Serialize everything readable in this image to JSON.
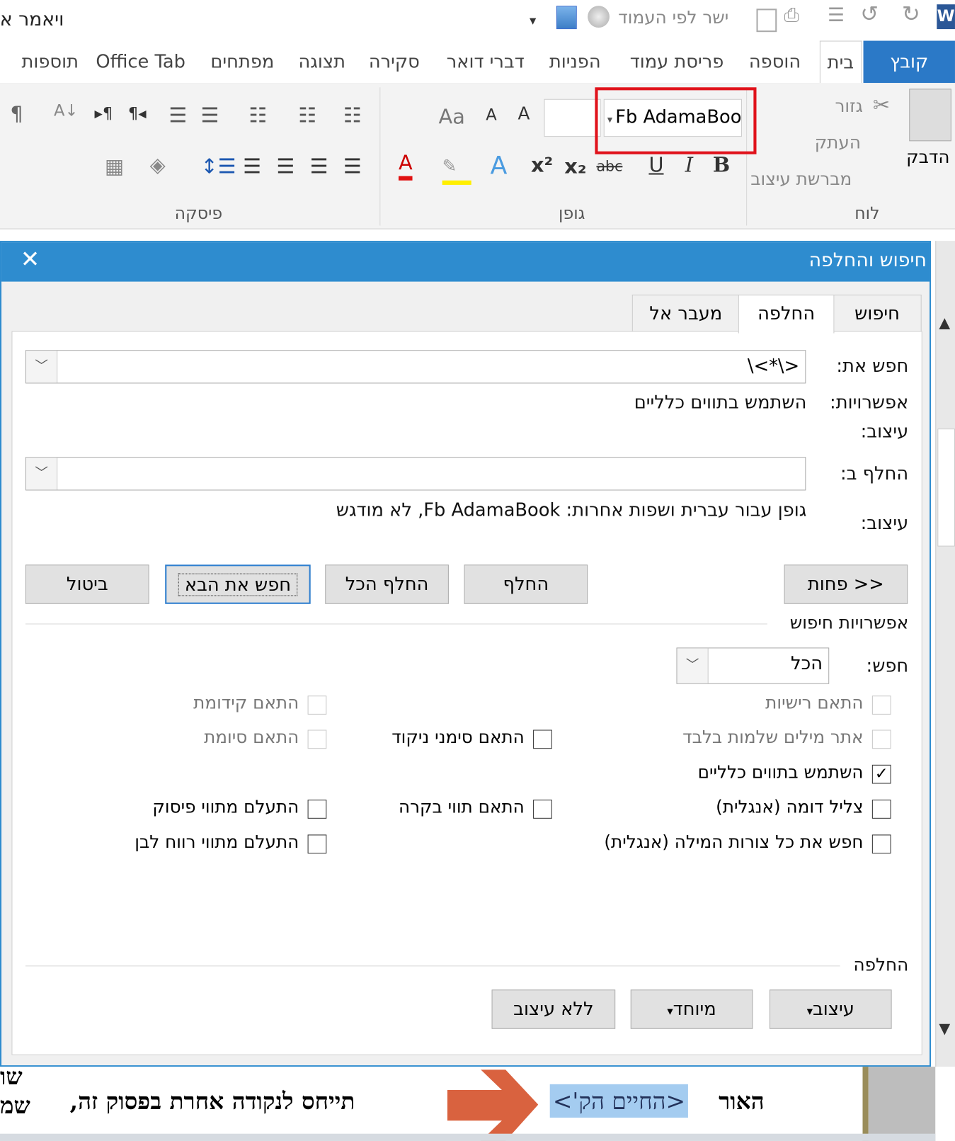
{
  "titlebar": {
    "document_title": "ויאמר א",
    "qat_fit_label": "ישר לפי העמוד",
    "word_icon": "W"
  },
  "ribbon_tabs": [
    "קובץ",
    "בית",
    "הוספה",
    "פריסת עמוד",
    "הפניות",
    "דברי דואר",
    "סקירה",
    "תצוגה",
    "מפתחים",
    "Office Tab",
    "תוספות"
  ],
  "ribbon": {
    "clipboard": {
      "label": "לוח",
      "paste": "הדבק",
      "cut": "גזור",
      "copy": "העתק",
      "format_painter": "מברשת עיצוב"
    },
    "font": {
      "label": "גופן",
      "font_name": "Fb AdamaBoo",
      "bold": "B",
      "italic": "I",
      "underline": "U",
      "strike": "abc",
      "sub": "x₂",
      "sup": "x²",
      "color_a": "A",
      "grow": "A",
      "shrink": "A",
      "case": "Aa"
    },
    "paragraph": {
      "label": "פיסקה",
      "pilcrow": "¶"
    }
  },
  "dialog": {
    "title": "חיפוש והחלפה",
    "tabs": [
      "חיפוש",
      "החלפה",
      "מעבר אל"
    ],
    "find_label": "חפש את:",
    "find_value": "\\<*\\>",
    "options_label": "אפשרויות:",
    "options_value": "השתמש בתווים כלליים",
    "format_label": "עיצוב:",
    "replace_label": "החלף ב:",
    "replace_value": "",
    "replace_format_label": "עיצוב:",
    "replace_format_value": "גופן עבור עברית ושפות אחרות: Fb AdamaBook, לא מודגש",
    "buttons": {
      "less": "<< פחות",
      "replace": "החלף",
      "replace_all": "החלף הכל",
      "find_next": "חפש את הבא",
      "cancel": "ביטול"
    },
    "search_options_title": "אפשרויות חיפוש",
    "search_label": "חפש:",
    "search_value": "הכל",
    "checkboxes": [
      {
        "label": "התאם רישיות",
        "checked": false,
        "disabled": true
      },
      {
        "label": "התאם קידומת",
        "checked": false,
        "disabled": true
      },
      {
        "label": "אתר מילים שלמות בלבד",
        "checked": false,
        "disabled": true
      },
      {
        "label": "התאם סימני ניקוד",
        "checked": false,
        "disabled": false
      },
      {
        "label": "התאם סיומת",
        "checked": false,
        "disabled": true
      },
      {
        "label": "השתמש בתווים כלליים",
        "checked": true,
        "disabled": false
      },
      {
        "label": "צליל דומה (אנגלית)",
        "checked": false,
        "disabled": false
      },
      {
        "label": "התאם תווי בקרה",
        "checked": false,
        "disabled": false
      },
      {
        "label": "התעלם מתווי פיסוק",
        "checked": false,
        "disabled": false
      },
      {
        "label": "חפש את כל צורות המילה (אנגלית)",
        "checked": false,
        "disabled": false
      },
      {
        "label": "התעלם מתווי רווח לבן",
        "checked": false,
        "disabled": false
      }
    ],
    "replace_section_title": "החלפה",
    "bottom_buttons": {
      "format": "עיצוב",
      "special": "מיוחד",
      "no_format": "ללא עיצוב"
    }
  },
  "document": {
    "word1": "האור",
    "highlight": "<החיים הק'>",
    "rest": "תייחס לנקודה אחרת בפסוק זה,",
    "edge1": "שו",
    "edge2": "שמ"
  },
  "colors": {
    "accent": "#2e8ccf",
    "file_tab": "#2b79c7",
    "highlight": "#a4ccf0",
    "arrow": "#d9623f",
    "red_box": "#e0121b"
  }
}
